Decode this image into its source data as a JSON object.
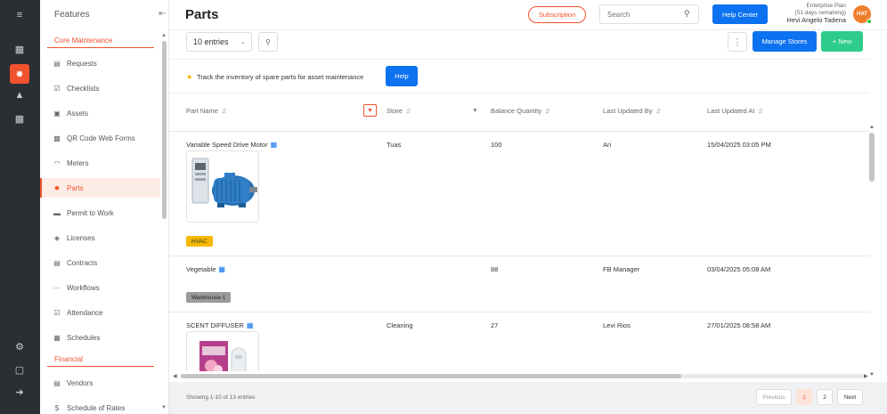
{
  "rail": {
    "icons": [
      "collapse-menu-icon",
      "dashboard-icon",
      "maintenance-icon",
      "org-chart-icon",
      "analytics-icon",
      "settings-icon",
      "box-icon",
      "logout-icon"
    ]
  },
  "sidebar": {
    "title": "Features",
    "groups": [
      {
        "label": "Core Maintenance"
      },
      {
        "label": "Financial"
      }
    ],
    "items": [
      {
        "label": "Requests",
        "icon": "requests-icon"
      },
      {
        "label": "Checklists",
        "icon": "checklists-icon"
      },
      {
        "label": "Assets",
        "icon": "assets-icon"
      },
      {
        "label": "QR Code Web Forms",
        "icon": "qr-code-icon"
      },
      {
        "label": "Meters",
        "icon": "meters-icon"
      },
      {
        "label": "Parts",
        "icon": "parts-icon",
        "active": true
      },
      {
        "label": "Permit to Work",
        "icon": "permit-icon"
      },
      {
        "label": "Licenses",
        "icon": "licenses-icon"
      },
      {
        "label": "Contracts",
        "icon": "contracts-icon"
      },
      {
        "label": "Workflows",
        "icon": "workflows-icon"
      },
      {
        "label": "Attendance",
        "icon": "attendance-icon"
      },
      {
        "label": "Schedules",
        "icon": "schedules-icon"
      },
      {
        "label": "Vendors",
        "icon": "vendors-icon"
      },
      {
        "label": "Schedule of Rates",
        "icon": "dollar-icon"
      }
    ]
  },
  "header": {
    "title": "Parts",
    "subscription_label": "Subscription",
    "search_placeholder": "Search",
    "help_center_label": "Help Center",
    "plan_name": "Enterprise Plan",
    "plan_days": "(51 days remaining)",
    "user_name": "Hevi Angelo Tadena",
    "avatar_initials": "HAT"
  },
  "toolbar": {
    "entries_value": "10 entries",
    "manage_stores_label": "Manage Stores",
    "new_label": "+  New"
  },
  "hint": {
    "text": "Track the inventory of spare parts for asset maintenance",
    "help_label": "Help"
  },
  "table": {
    "columns": [
      "Part Name",
      "Store",
      "Balance Quantity",
      "Last Updated By",
      "Last Updated At"
    ],
    "rows": [
      {
        "part_name": "Variable Speed Drive Motor",
        "store": "Tuas",
        "balance": "100",
        "updated_by": "Ari",
        "updated_at": "15/04/2025 03:05 PM",
        "tag": "HVAC",
        "tag_color": "#f6b800"
      },
      {
        "part_name": "Vegetable",
        "store": "",
        "balance": "88",
        "updated_by": "FB Manager",
        "updated_at": "03/04/2025 05:08 AM",
        "tag": "Warehouse 1",
        "tag_color": "#9a9a9a"
      },
      {
        "part_name": "SCENT DIFFUSER",
        "store": "Cleaning",
        "balance": "27",
        "updated_by": "Levi Rios",
        "updated_at": "27/01/2025 08:58 AM"
      }
    ]
  },
  "footer": {
    "showing": "Showing 1-10 of 13 entries",
    "previous": "Previous",
    "pages": [
      "1",
      "2"
    ],
    "current_page": "1",
    "next": "Next"
  },
  "colors": {
    "accent": "#f0532d",
    "primary": "#0d72f0",
    "success": "#2ecc8a",
    "rail_bg": "#2b2e33"
  }
}
